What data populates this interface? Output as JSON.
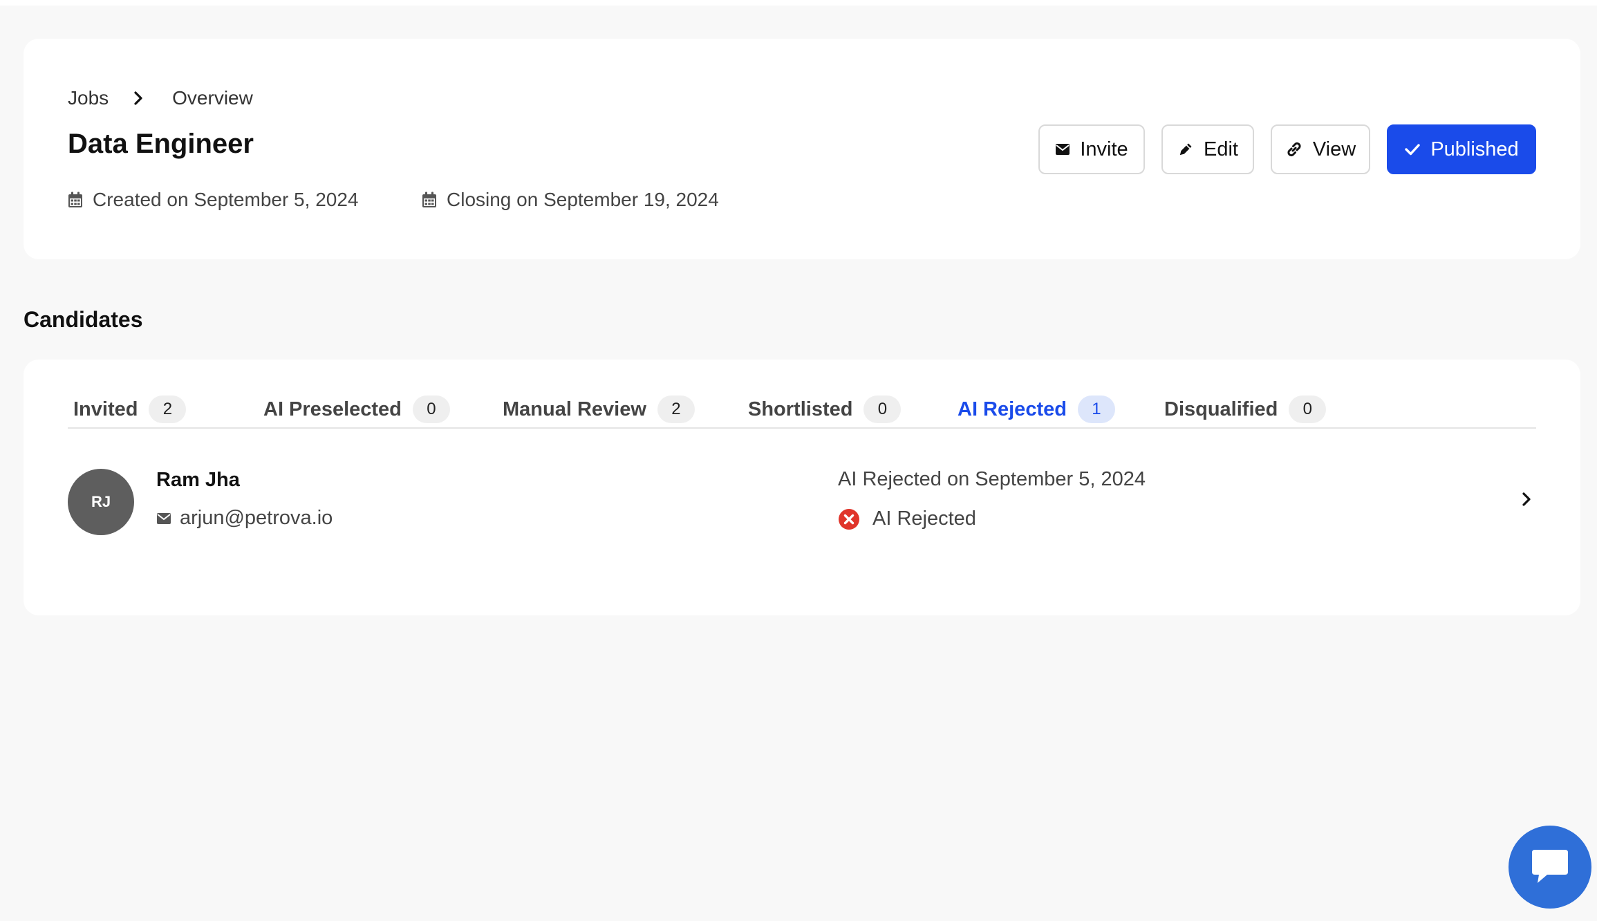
{
  "breadcrumb": {
    "root": "Jobs",
    "current": "Overview"
  },
  "job": {
    "title": "Data Engineer",
    "created": "Created on September 5, 2024",
    "closing": "Closing on September 19, 2024"
  },
  "actions": {
    "invite": "Invite",
    "edit": "Edit",
    "view": "View",
    "published": "Published"
  },
  "candidates_title": "Candidates",
  "tabs": [
    {
      "label": "Invited",
      "count": "2"
    },
    {
      "label": "AI Preselected",
      "count": "0"
    },
    {
      "label": "Manual Review",
      "count": "2"
    },
    {
      "label": "Shortlisted",
      "count": "0"
    },
    {
      "label": "AI Rejected",
      "count": "1",
      "active": true
    },
    {
      "label": "Disqualified",
      "count": "0"
    }
  ],
  "candidate": {
    "initials": "RJ",
    "name": "Ram Jha",
    "email": "arjun@petrova.io",
    "status_date": "AI Rejected on September 5, 2024",
    "status": "AI Rejected"
  },
  "colors": {
    "accent": "#1a4bea",
    "reject": "#e0352b",
    "chat": "#2f6fd8",
    "avatar": "#5e5e5e"
  },
  "icons": [
    "calendar-icon",
    "mail-icon",
    "pencil-icon",
    "link-icon",
    "check-icon",
    "chevron-right-icon",
    "x-circle-icon",
    "chat-icon"
  ]
}
